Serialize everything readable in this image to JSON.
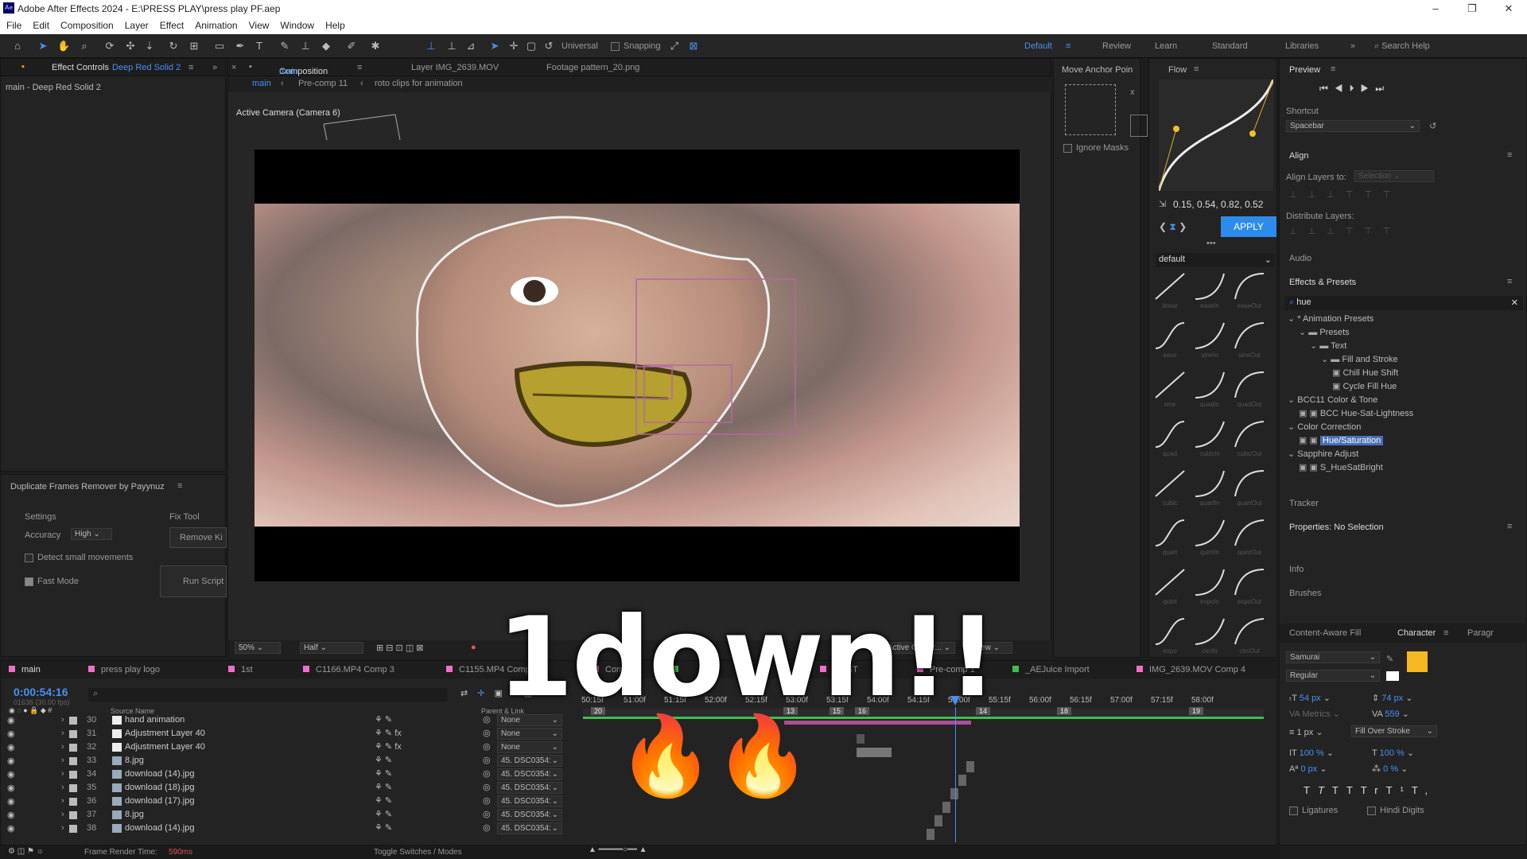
{
  "titlebar": {
    "icon": "Ae",
    "title": "Adobe After Effects 2024 - E:\\PRESS PLAY\\press play PF.aep",
    "min": "–",
    "max": "❐",
    "close": "✕"
  },
  "menu": [
    "File",
    "Edit",
    "Composition",
    "Layer",
    "Effect",
    "Animation",
    "View",
    "Window",
    "Help"
  ],
  "toolbar": {
    "universal": "Universal",
    "snapping": "Snapping",
    "workspaces": [
      "Default",
      "Review",
      "Learn",
      "Standard",
      "Libraries"
    ],
    "search": "Search Help"
  },
  "effect_controls": {
    "tab": "Effect Controls",
    "layer": "Deep Red Solid 2",
    "header": "main - Deep Red Solid 2"
  },
  "composition": {
    "tab": "Composition",
    "name": "main",
    "layer_tab": "Layer IMG_2639.MOV",
    "footage_tab": "Footage pattern_20.png",
    "breadcrumbs": [
      "main",
      "Pre-comp 11",
      "roto clips for animation"
    ],
    "camera": "Active Camera (Camera 6)",
    "zoom": "50%",
    "resolution": "Half",
    "view_camera": "Active Camer...",
    "views": "1 View"
  },
  "dup_frames": {
    "title": "Duplicate Frames Remover by Payynuz",
    "settings": "Settings",
    "accuracy_label": "Accuracy",
    "accuracy": "High",
    "detect": "Detect small movements",
    "fast": "Fast Mode",
    "fix_tool": "Fix Tool",
    "remove": "Remove Ki",
    "run": "Run Script"
  },
  "anchor": {
    "title": "Move Anchor Poin",
    "x": "x",
    "ignore": "Ignore Masks"
  },
  "flow": {
    "title": "Flow",
    "values": "0.15, 0.54, 0.82, 0.52",
    "apply": "APPLY",
    "preset": "default",
    "curves": [
      "linear",
      "easeIn",
      "easeOut",
      "ease",
      "sineIn",
      "sineOut",
      "sine",
      "quadIn",
      "quadOut",
      "quad",
      "cubicIn",
      "cubicOut",
      "cubic",
      "quartIn",
      "quartOut",
      "quart",
      "quintIn",
      "quintOut",
      "quint",
      "expoIn",
      "expoOut",
      "expo",
      "circIn",
      "circOut"
    ]
  },
  "preview": {
    "title": "Preview",
    "shortcut_label": "Shortcut",
    "shortcut": "Spacebar"
  },
  "align": {
    "title": "Align",
    "layers_to": "Align Layers to:",
    "selection": "Selection",
    "distribute": "Distribute Layers:"
  },
  "audio": "Audio",
  "effects_presets": {
    "title": "Effects & Presets",
    "search": "hue",
    "tree": [
      {
        "label": "* Animation Presets",
        "level": 0,
        "type": "twirl"
      },
      {
        "label": "Presets",
        "level": 1,
        "type": "folder"
      },
      {
        "label": "Text",
        "level": 2,
        "type": "folder"
      },
      {
        "label": "Fill and Stroke",
        "level": 3,
        "type": "folder"
      },
      {
        "label": "Chill Hue Shift",
        "level": 4,
        "type": "preset"
      },
      {
        "label": "Cycle Fill Hue",
        "level": 4,
        "type": "preset"
      },
      {
        "label": "BCC11 Color & Tone",
        "level": 0,
        "type": "twirl"
      },
      {
        "label": "BCC Hue-Sat-Lightness",
        "level": 1,
        "type": "effect"
      },
      {
        "label": "Color Correction",
        "level": 0,
        "type": "twirl"
      },
      {
        "label": "Hue/Saturation",
        "level": 1,
        "type": "effect",
        "selected": true
      },
      {
        "label": "Sapphire Adjust",
        "level": 0,
        "type": "twirl"
      },
      {
        "label": "S_HueSatBright",
        "level": 1,
        "type": "effect"
      }
    ]
  },
  "tracker": "Tracker",
  "properties": "Properties: No Selection",
  "info": "Info",
  "brushes": "Brushes",
  "character": {
    "caf": "Content-Aware Fill",
    "title": "Character",
    "para": "Paragr",
    "font": "Samurai",
    "style": "Regular",
    "size": "54 px",
    "leading": "74 px",
    "kerning": "Metrics",
    "tracking": "559",
    "stroke": "1 px",
    "stroke_type": "Fill Over Stroke",
    "vscale": "100 %",
    "hscale": "100 %",
    "baseline": "0 px",
    "tsume": "0 %",
    "styles": [
      "T",
      "T",
      "TT",
      "Tr",
      "T¹",
      "T,"
    ],
    "ligatures": "Ligatures",
    "hindi": "Hindi Digits"
  },
  "timeline": {
    "tabs": [
      "main",
      "press play logo",
      "1st",
      "C1166.MP4 Comp 3",
      "C1155.MP4 Comp",
      "Comp",
      "",
      "FIRST",
      "Pre-comp 1",
      "_AEJuice Import",
      "IMG_2639.MOV Comp 4"
    ],
    "timecode": "0:00:54:16",
    "frames": "01636 (30.00 fps)",
    "col_source": "Source Name",
    "col_parent": "Parent & Link",
    "ruler": [
      "50:15f",
      "51:00f",
      "51:15f",
      "52:00f",
      "52:15f",
      "53:00f",
      "53:15f",
      "54:00f",
      "54:15f",
      "55:00f",
      "55:15f",
      "56:00f",
      "56:15f",
      "57:00f",
      "57:15f",
      "58:00f"
    ],
    "layers": [
      {
        "num": "30",
        "name": "hand animation",
        "parent": "None"
      },
      {
        "num": "31",
        "name": "Adjustment Layer 40",
        "parent": "None"
      },
      {
        "num": "32",
        "name": "Adjustment Layer 40",
        "parent": "None"
      },
      {
        "num": "33",
        "name": "8.jpg",
        "parent": "45. DSC0354:"
      },
      {
        "num": "34",
        "name": "download (14).jpg",
        "parent": "45. DSC0354:"
      },
      {
        "num": "35",
        "name": "download (18).jpg",
        "parent": "45. DSC0354:"
      },
      {
        "num": "36",
        "name": "download (17).jpg",
        "parent": "45. DSC0354:"
      },
      {
        "num": "37",
        "name": "8.jpg",
        "parent": "45. DSC0354:"
      },
      {
        "num": "38",
        "name": "download (14).jpg",
        "parent": "45. DSC0354:"
      }
    ],
    "markers": [
      "20",
      "13",
      "15",
      "16",
      "14",
      "18",
      "19"
    ],
    "render_label": "Frame Render Time:",
    "render_time": "590ms",
    "toggle": "Toggle Switches / Modes"
  },
  "overlay": {
    "text": "1down!!",
    "fire": "🔥"
  },
  "colors": {
    "accent": "#2d8ceb",
    "selected": "#4b6fb5"
  }
}
